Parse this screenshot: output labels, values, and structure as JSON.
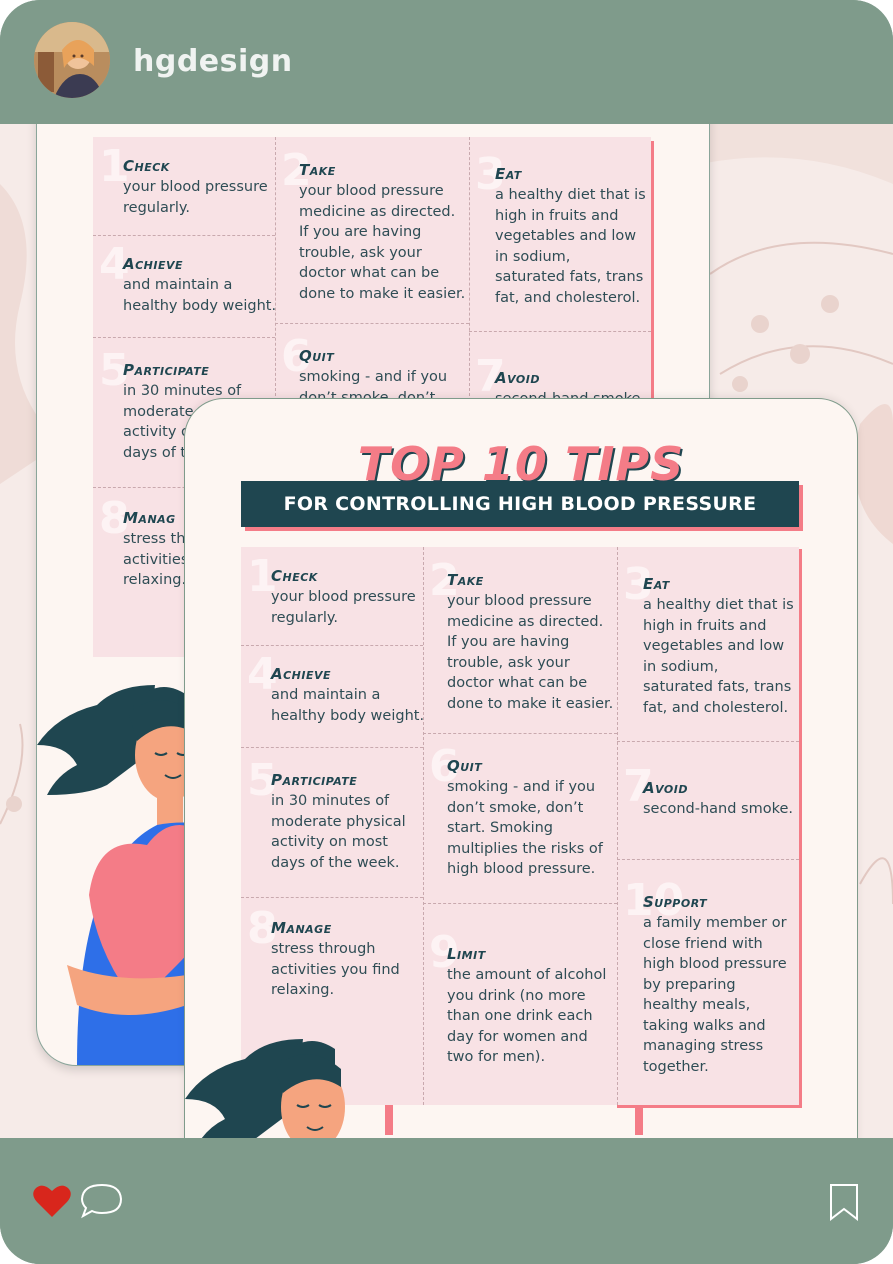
{
  "account": {
    "username": "hgdesign"
  },
  "poster": {
    "headline": "TOP 10 TIPS",
    "subtitle": "FOR CONTROLLING HIGH BLOOD PRESSURE",
    "tips": [
      {
        "num": "1",
        "title": "Check",
        "body": [
          "your blood pressure",
          "regularly."
        ]
      },
      {
        "num": "2",
        "title": "Take",
        "body": [
          "your blood pressure",
          "medicine as directed.",
          "If you are having",
          "trouble, ask your",
          "doctor what can be",
          "done to make it easier."
        ]
      },
      {
        "num": "3",
        "title": "Eat",
        "body": [
          "a healthy diet that is",
          "high in fruits and",
          "vegetables and low",
          "in sodium,",
          "saturated fats, trans",
          "fat, and cholesterol."
        ]
      },
      {
        "num": "4",
        "title": "Achieve",
        "body": [
          "and maintain a",
          "healthy body weight."
        ]
      },
      {
        "num": "5",
        "title": "Participate",
        "body": [
          "in 30 minutes of",
          "moderate physical",
          "activity on most",
          "days of the week."
        ]
      },
      {
        "num": "6",
        "title": "Quit",
        "body": [
          "smoking - and if you",
          "don’t smoke, don’t",
          "start. Smoking",
          "multiplies the risks of",
          "high blood pressure."
        ]
      },
      {
        "num": "7",
        "title": "Avoid",
        "body": [
          "second-hand smoke."
        ]
      },
      {
        "num": "8",
        "title": "Manage",
        "body": [
          "stress through",
          "activities you find",
          "relaxing."
        ]
      },
      {
        "num": "9",
        "title": "Limit",
        "body": [
          "the amount of alcohol",
          "you drink (no more",
          "than one drink each",
          "day for women and",
          "two for men)."
        ]
      },
      {
        "num": "10",
        "title": "Support",
        "body": [
          "a family member or",
          "close friend with",
          "high blood pressure",
          "by preparing",
          "healthy meals,",
          "taking walks and",
          "managing stress",
          "together."
        ]
      }
    ],
    "back_partial": {
      "avoid_partial": "second-hand smoke.",
      "participate_partial": [
        "in 30 minutes of",
        "moderate ph",
        "activity on",
        "days of th"
      ],
      "manage_partial": [
        "stress th",
        "activities",
        "relaxing."
      ],
      "quit_partial": [
        "smoking - and if you",
        "don’t smoke, don’t"
      ],
      "manage_title": "Manag"
    }
  },
  "actions": {
    "like": "heart-icon",
    "comment": "comment-icon",
    "save": "bookmark-icon"
  },
  "colors": {
    "frame": "#7f9b8b",
    "accent": "#f47c87",
    "navy": "#1f4650",
    "like": "#d8261c"
  }
}
